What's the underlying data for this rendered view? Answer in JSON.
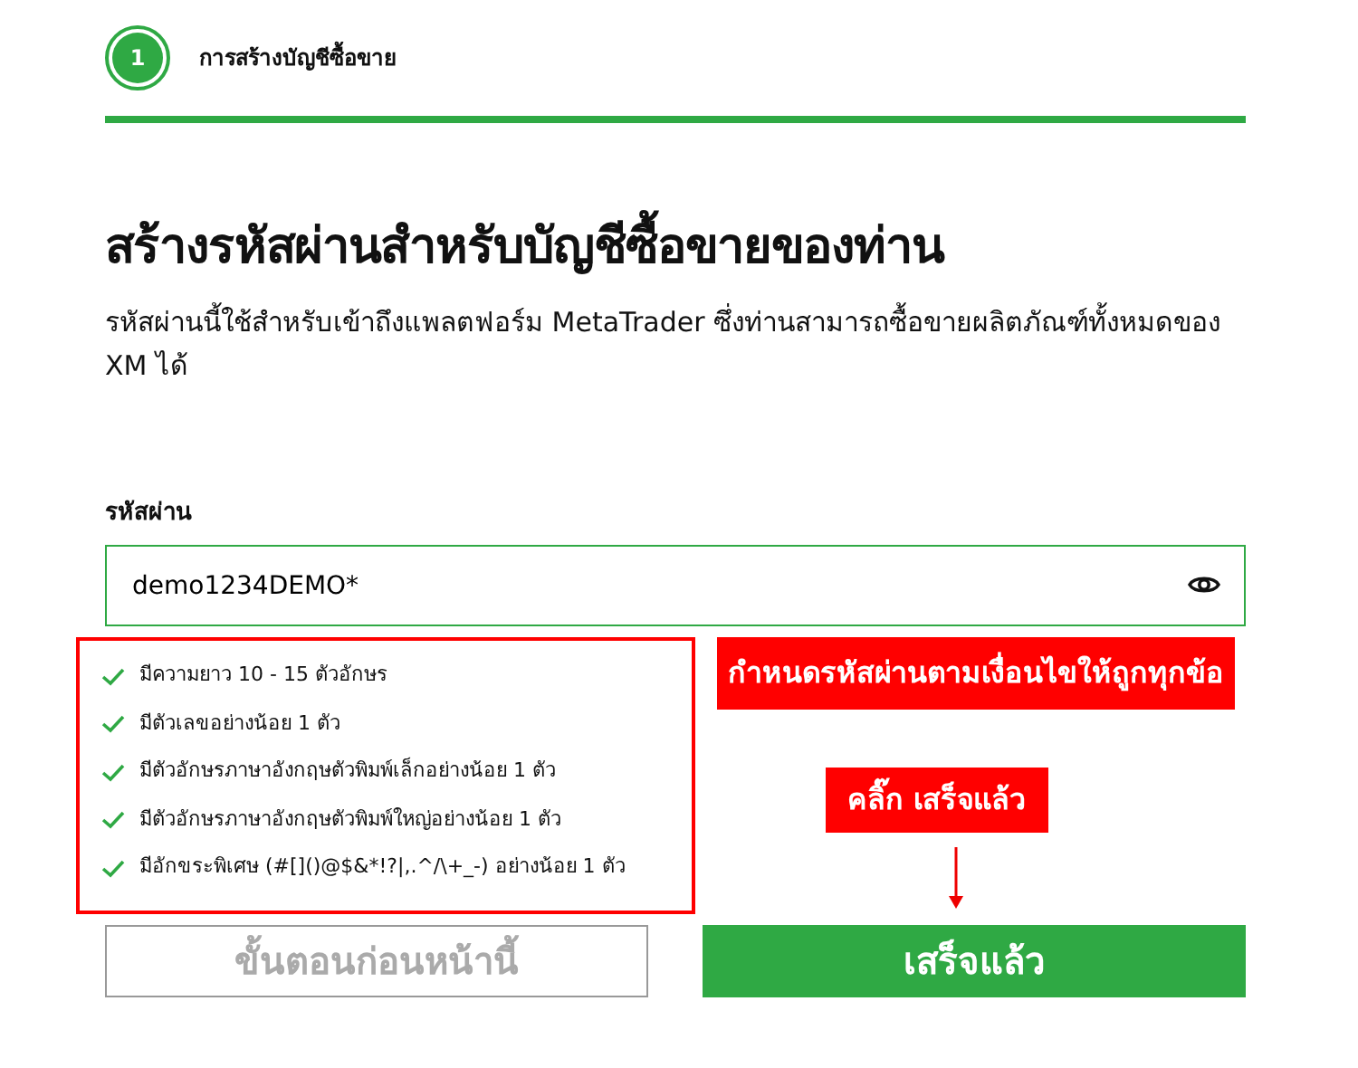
{
  "steps": [
    {
      "number": "1",
      "label": "การสร้างบัญชีซื้อขาย",
      "selected": true
    }
  ],
  "title": "สร้างรหัสผ่านสำหรับบัญชีซื้อขายของท่าน",
  "description": "รหัสผ่านนี้ใช้สำหรับเข้าถึงแพลตฟอร์ม MetaTrader ซึ่งท่านสามารถซื้อขายผลิตภัณฑ์ทั้งหมดของ XM ได้",
  "password": {
    "label": "รหัสผ่าน",
    "value": "demo1234DEMO*"
  },
  "rules": [
    {
      "text": "มีความยาว 10 - 15 ตัวอักษร",
      "met": true
    },
    {
      "text": "มีตัวเลขอย่างน้อย 1 ตัว",
      "met": true
    },
    {
      "text": "มีตัวอักษรภาษาอังกฤษตัวพิมพ์เล็กอย่างน้อย 1 ตัว",
      "met": true
    },
    {
      "text": "มีตัวอักษรภาษาอังกฤษตัวพิมพ์ใหญ่อย่างน้อย 1 ตัว",
      "met": true
    },
    {
      "text": "มีอักขระพิเศษ (#[]()@$&*!?|,.^/\\+_-) อย่างน้อย 1 ตัว",
      "met": true
    }
  ],
  "annotations": [
    "กำหนดรหัสผ่านตามเงื่อนไขให้ถูกทุกข้อ",
    "คลิ๊ก เสร็จแล้ว"
  ],
  "buttons": [
    {
      "label": "ขั้นตอนก่อนหน้านี้",
      "kind": "secondary"
    },
    {
      "label": "เสร็จแล้ว",
      "kind": "primary"
    }
  ]
}
